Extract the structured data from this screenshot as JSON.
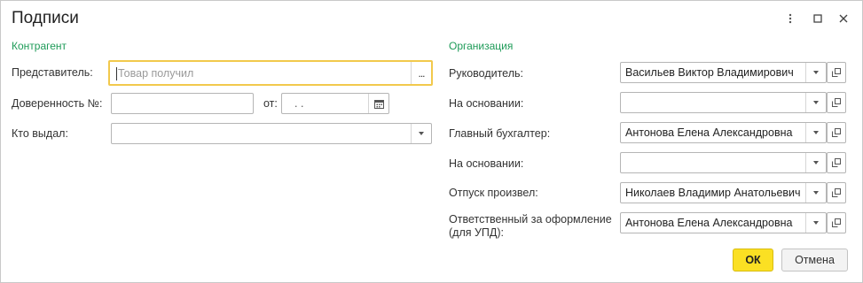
{
  "window": {
    "title": "Подписи",
    "menu_icon": "vertical-dots-icon",
    "maximize_icon": "square-icon",
    "close_icon": "close-icon"
  },
  "left": {
    "section_title": "Контрагент",
    "representative": {
      "label": "Представитель:",
      "placeholder": "Товар получил",
      "button": "..."
    },
    "power_of_attorney": {
      "label": "Доверенность №:",
      "value": "",
      "date_label": "от:",
      "date_value": " .  ."
    },
    "issued_by": {
      "label": "Кто выдал:",
      "value": ""
    }
  },
  "right": {
    "section_title": "Организация",
    "fields": [
      {
        "label": "Руководитель:",
        "value": "Васильев Виктор Владимирович"
      },
      {
        "label": "На основании:",
        "value": ""
      },
      {
        "label": "Главный бухгалтер:",
        "value": "Антонова Елена Александровна"
      },
      {
        "label": "На основании:",
        "value": ""
      },
      {
        "label": "Отпуск произвел:",
        "value": "Николаев Владимир Анатольевич"
      },
      {
        "label": "Ответственный за оформление (для УПД):",
        "value": "Антонова Елена Александровна"
      }
    ]
  },
  "buttons": {
    "ok": "ОК",
    "cancel": "Отмена"
  },
  "colors": {
    "accent_green": "#1e9b58",
    "ok_yellow": "#fbe023",
    "focus_border": "#f2c94c"
  }
}
